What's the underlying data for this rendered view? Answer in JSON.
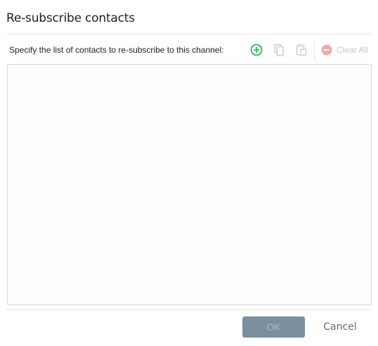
{
  "dialog": {
    "title": "Re-subscribe contacts"
  },
  "toolbar": {
    "instruction": "Specify the list of contacts to re-subscribe to this channel:",
    "add_icon": "add-circle-icon",
    "copy_icon": "copy-icon",
    "paste_icon": "paste-icon",
    "clear_all_label": "Clear All",
    "clear_all_icon": "minus-circle-icon"
  },
  "contacts_list": {
    "items": []
  },
  "footer": {
    "ok_label": "OK",
    "cancel_label": "Cancel"
  },
  "colors": {
    "accent_green": "#2dbb54",
    "disabled_gray": "#c7c7c7",
    "clear_red_disabled": "#f0a9a9",
    "ok_button_bg": "#7a909f",
    "cancel_text": "#5f6f7b"
  }
}
